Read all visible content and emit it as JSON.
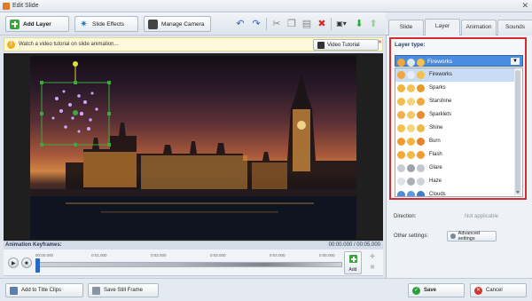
{
  "window": {
    "title": "Edit Slide",
    "close_glyph": "✕"
  },
  "toolbar": {
    "add_layer": "Add Layer",
    "slide_effects": "Slide Effects",
    "manage_camera": "Manage Camera"
  },
  "tabs": [
    {
      "label": "Slide"
    },
    {
      "label": "Layer",
      "active": true
    },
    {
      "label": "Animation"
    },
    {
      "label": "Sounds"
    }
  ],
  "info_bar": {
    "text": "Watch a video tutorial on slide animation...",
    "button": "Video Tutorial",
    "close": "✕"
  },
  "keyframes": {
    "header": "Animation Keyframes:",
    "time": "00:00.000 / 00:05.000",
    "ticks": [
      "00:00.000",
      "0:01.000",
      "0:02.000",
      "0:03.000",
      "0:04.000",
      "0:05.000"
    ],
    "add_label": "Add"
  },
  "bottom": {
    "add_to_title_clips": "Add to Title Clips",
    "save_still_frame": "Save Still Frame",
    "save": "Save",
    "cancel": "Cancel"
  },
  "layer_panel": {
    "label": "Layer type:",
    "selected": "Fireworks",
    "options": [
      "Fireworks",
      "Sparks",
      "Starshine",
      "Sparklets",
      "Shine",
      "Burn",
      "Flash",
      "Glare",
      "Haze",
      "Clouds"
    ]
  },
  "properties": {
    "direction_label": "Direction:",
    "direction_value": "Not applicable",
    "other_label": "Other settings:",
    "advanced_button": "Advanced settings"
  },
  "colors": {
    "accent": "#4a8de0",
    "highlight_border": "#d42d2d",
    "add_green": "#3aa63a"
  }
}
